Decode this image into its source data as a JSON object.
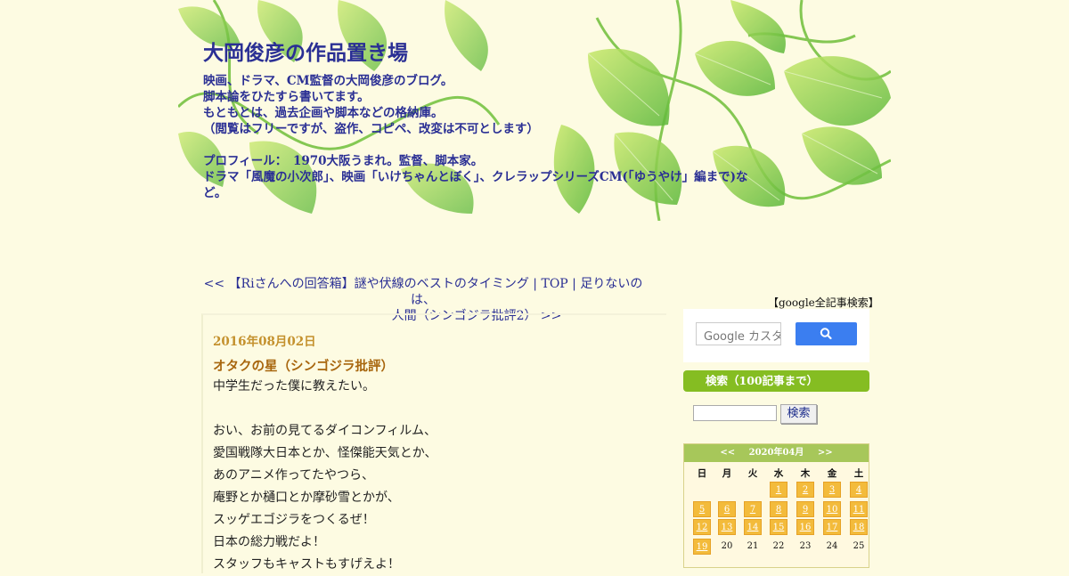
{
  "header": {
    "title": "大岡俊彦の作品置き場",
    "desc_lines": [
      "映画、ドラマ、CM監督の大岡俊彦のブログ。",
      "脚本論をひたすら書いてます。",
      "もともとは、過去企画や脚本などの格納庫。",
      "（閲覧はフリーですが、盗作、コピペ、改変は不可とします）",
      "",
      "プロフィール：　1970大阪うまれ。監督、脚本家。",
      "ドラマ「風魔の小次郎」、映画「いけちゃんとぼく」、クレラップシリーズCM(「ゆうやけ」編まで)な",
      "ど。"
    ]
  },
  "nav": {
    "prev": "<< 【Riさんへの回答箱】謎や伏線のベストのタイミング",
    "sep1": " | ",
    "top": "TOP",
    "sep2": " | ",
    "next_line1": "足りないのは、",
    "next_line2": "人間（シンゴジラ批評2） >>"
  },
  "entry": {
    "date": "2016年08月02日",
    "title": "オタクの星（シンゴジラ批評）",
    "body": [
      "中学生だった僕に教えたい。",
      "",
      "おい、お前の見てるダイコンフィルム、",
      "愛国戦隊大日本とか、怪傑能天気とか、",
      "あのアニメ作ってたやつら、",
      "庵野とか樋口とか摩砂雪とかが、",
      "スッゲエゴジラをつくるぜ！",
      "日本の総力戦だよ！",
      "スタッフもキャストもすげえよ！"
    ]
  },
  "sidebar": {
    "google_title": "【google全記事検索】",
    "google_placeholder": "Google カスタム検索",
    "search_title": "検索（100記事まで）",
    "search_button": "検索"
  },
  "calendar": {
    "prev": "<<",
    "month": "2020年04月",
    "next": ">>",
    "dows": [
      "日",
      "月",
      "火",
      "水",
      "木",
      "金",
      "土"
    ],
    "weeks": [
      [
        null,
        null,
        null,
        {
          "d": "1",
          "link": true
        },
        {
          "d": "2",
          "link": true
        },
        {
          "d": "3",
          "link": true
        },
        {
          "d": "4",
          "link": true
        }
      ],
      [
        {
          "d": "5",
          "link": true
        },
        {
          "d": "6",
          "link": true
        },
        {
          "d": "7",
          "link": true
        },
        {
          "d": "8",
          "link": true
        },
        {
          "d": "9",
          "link": true
        },
        {
          "d": "10",
          "link": true
        },
        {
          "d": "11",
          "link": true
        }
      ],
      [
        {
          "d": "12",
          "link": true
        },
        {
          "d": "13",
          "link": true
        },
        {
          "d": "14",
          "link": true
        },
        {
          "d": "15",
          "link": true
        },
        {
          "d": "16",
          "link": true
        },
        {
          "d": "17",
          "link": true
        },
        {
          "d": "18",
          "link": true
        }
      ],
      [
        {
          "d": "19",
          "link": true
        },
        {
          "d": "20",
          "link": false
        },
        {
          "d": "21",
          "link": false
        },
        {
          "d": "22",
          "link": false
        },
        {
          "d": "23",
          "link": false
        },
        {
          "d": "24",
          "link": false
        },
        {
          "d": "25",
          "link": false
        }
      ]
    ]
  },
  "colors": {
    "page_bg": "#fdfbe2",
    "title_blue": "#2a2f94",
    "date_gold": "#c4912d",
    "entry_title": "#a8660e",
    "sidebar_green": "#85bd22",
    "calendar_link": "#f3bb3b",
    "google_button": "#3b7ef0"
  }
}
